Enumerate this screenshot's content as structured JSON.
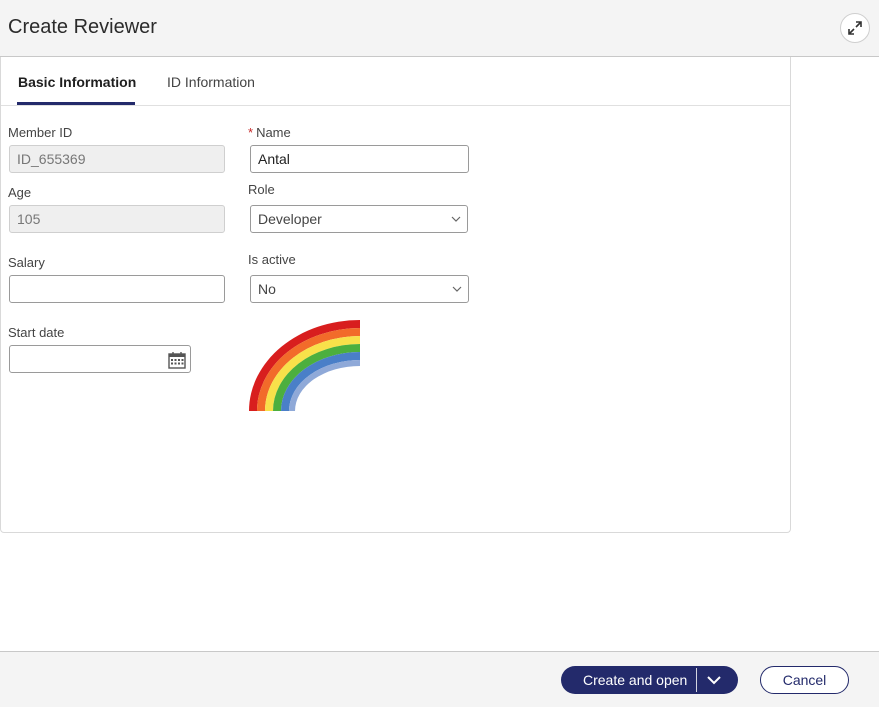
{
  "dialog": {
    "title": "Create Reviewer"
  },
  "tabs": [
    {
      "label": "Basic Information",
      "active": true
    },
    {
      "label": "ID Information",
      "active": false
    }
  ],
  "form": {
    "member_id": {
      "label": "Member ID",
      "value": "ID_655369",
      "disabled": true
    },
    "name": {
      "label": "Name",
      "required": true,
      "value": "Antal"
    },
    "age": {
      "label": "Age",
      "value": "105",
      "disabled": true
    },
    "role": {
      "label": "Role",
      "value": "Developer"
    },
    "salary": {
      "label": "Salary",
      "value": ""
    },
    "is_active": {
      "label": "Is active",
      "value": "No"
    },
    "start_date": {
      "label": "Start date",
      "value": ""
    }
  },
  "footer": {
    "create_open_label": "Create and open",
    "cancel_label": "Cancel"
  },
  "colors": {
    "accent": "#232a6b",
    "required": "#c62828"
  },
  "icons": {
    "expand": "expand-arrows-icon",
    "chevron": "chevron-down-icon",
    "calendar": "calendar-icon"
  }
}
